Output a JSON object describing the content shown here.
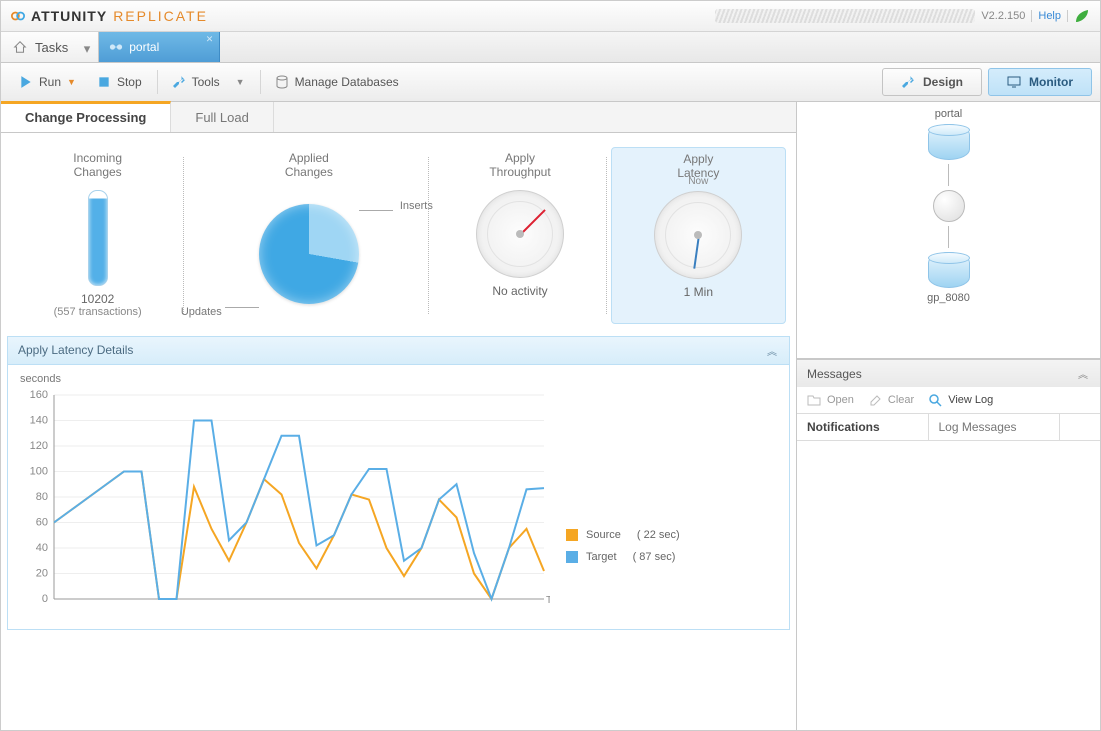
{
  "brand": {
    "name1": "ATTUNITY",
    "name2": "REPLICATE"
  },
  "topbar": {
    "version": "V2.2.150",
    "help": "Help"
  },
  "tabs": {
    "home": "Tasks",
    "task": "portal"
  },
  "toolbar": {
    "run": "Run",
    "stop": "Stop",
    "tools": "Tools",
    "manage": "Manage Databases"
  },
  "modes": {
    "design": "Design",
    "monitor": "Monitor"
  },
  "subtabs": {
    "cp": "Change Processing",
    "fl": "Full Load"
  },
  "cards": {
    "incoming": {
      "title": "Incoming\nChanges",
      "value": "10202",
      "sub": "(557 transactions)"
    },
    "applied": {
      "title": "Applied\nChanges",
      "inserts": "Inserts",
      "updates": "Updates"
    },
    "throughput": {
      "title": "Apply\nThroughput",
      "status": "No activity"
    },
    "latency": {
      "title": "Apply\nLatency",
      "top": "Now",
      "status": "1 Min"
    }
  },
  "details": {
    "title": "Apply Latency Details",
    "ylabel": "seconds",
    "xlabel": "Time",
    "legend": {
      "source": "Source",
      "target": "Target",
      "source_val": "( 22 sec)",
      "target_val": "( 87 sec)"
    }
  },
  "diagram": {
    "src": "portal",
    "tgt": "gp_8080"
  },
  "messages": {
    "title": "Messages",
    "open": "Open",
    "clear": "Clear",
    "viewlog": "View Log",
    "tab1": "Notifications",
    "tab2": "Log Messages"
  },
  "chart_data": {
    "type": "line",
    "ylabel": "seconds",
    "xlabel": "Time",
    "ylim": [
      0,
      160
    ],
    "yticks": [
      0,
      20,
      40,
      60,
      80,
      100,
      120,
      140,
      160
    ],
    "x": [
      0,
      1,
      2,
      3,
      4,
      5,
      6,
      7,
      8,
      9,
      10,
      11,
      12,
      13,
      14,
      15,
      16,
      17,
      18,
      19,
      20,
      21,
      22,
      23,
      24,
      25,
      26,
      27,
      28
    ],
    "series": [
      {
        "name": "Source",
        "color": "#f5a623",
        "current": "22 sec",
        "values": [
          60,
          70,
          80,
          90,
          100,
          100,
          0,
          0,
          88,
          55,
          30,
          60,
          94,
          82,
          44,
          24,
          50,
          82,
          78,
          40,
          18,
          40,
          78,
          64,
          20,
          0,
          40,
          55,
          22
        ]
      },
      {
        "name": "Target",
        "color": "#5aaee6",
        "current": "87 sec",
        "values": [
          60,
          70,
          80,
          90,
          100,
          100,
          0,
          0,
          140,
          140,
          46,
          60,
          94,
          128,
          128,
          42,
          50,
          82,
          102,
          102,
          30,
          40,
          78,
          90,
          36,
          0,
          40,
          86,
          87
        ]
      }
    ]
  },
  "colors": {
    "accent": "#f5a623",
    "blue": "#5aaee6",
    "panel": "#d7edfa"
  }
}
